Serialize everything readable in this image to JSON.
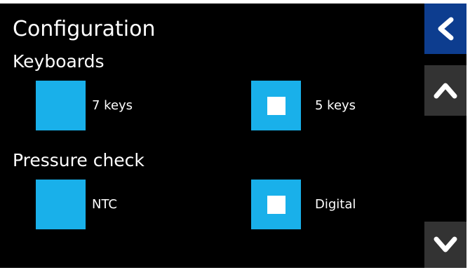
{
  "screen": {
    "title": "Configuration",
    "colors": {
      "background": "#000000",
      "option_box": "#19b0ea",
      "back_button": "#0d3d8f",
      "scroll_button": "#333333",
      "text": "#ffffff"
    }
  },
  "sections": {
    "keyboards": {
      "title": "Keyboards",
      "options": [
        {
          "label": "7 keys",
          "selected": false
        },
        {
          "label": "5 keys",
          "selected": true
        }
      ]
    },
    "pressure_check": {
      "title": "Pressure check",
      "options": [
        {
          "label": "NTC",
          "selected": false
        },
        {
          "label": "Digital",
          "selected": true
        }
      ]
    }
  },
  "sidebar": {
    "back_icon": "chevron-left-icon",
    "up_icon": "chevron-up-icon",
    "down_icon": "chevron-down-icon"
  }
}
